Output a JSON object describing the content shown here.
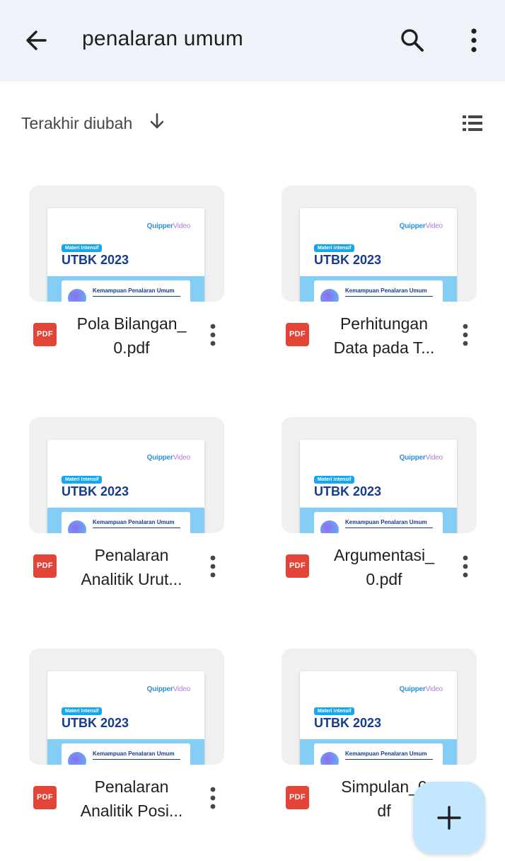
{
  "search": {
    "query": "penalaran umum"
  },
  "sort": {
    "label": "Terakhir diubah"
  },
  "thumbnail": {
    "brand_main": "Quipper",
    "brand_sub": "Video",
    "tag": "Materi Intensif",
    "headline": "UTBK 2023",
    "subtitle": "Kemampuan Penalaran Umum"
  },
  "files": [
    {
      "line1": "Pola Bilangan_",
      "line2": "0.pdf",
      "type": "PDF"
    },
    {
      "line1": "Perhitungan",
      "line2": "Data pada T...",
      "type": "PDF"
    },
    {
      "line1": "Penalaran",
      "line2": "Analitik Urut...",
      "type": "PDF"
    },
    {
      "line1": "Argumentasi_",
      "line2": "0.pdf",
      "type": "PDF"
    },
    {
      "line1": "Penalaran",
      "line2": "Analitik Posi...",
      "type": "PDF"
    },
    {
      "line1": "Simpulan_0",
      "line2": "df",
      "type": "PDF"
    }
  ],
  "icons": {
    "back": "arrow-back-icon",
    "search": "search-icon",
    "more": "more-vert-icon",
    "sort": "arrow-down-icon",
    "view": "list-view-icon",
    "fab": "plus-icon"
  },
  "colors": {
    "topbar": "#eef2f9",
    "pdf_badge": "#e34438",
    "fab": "#c2e7ff"
  }
}
